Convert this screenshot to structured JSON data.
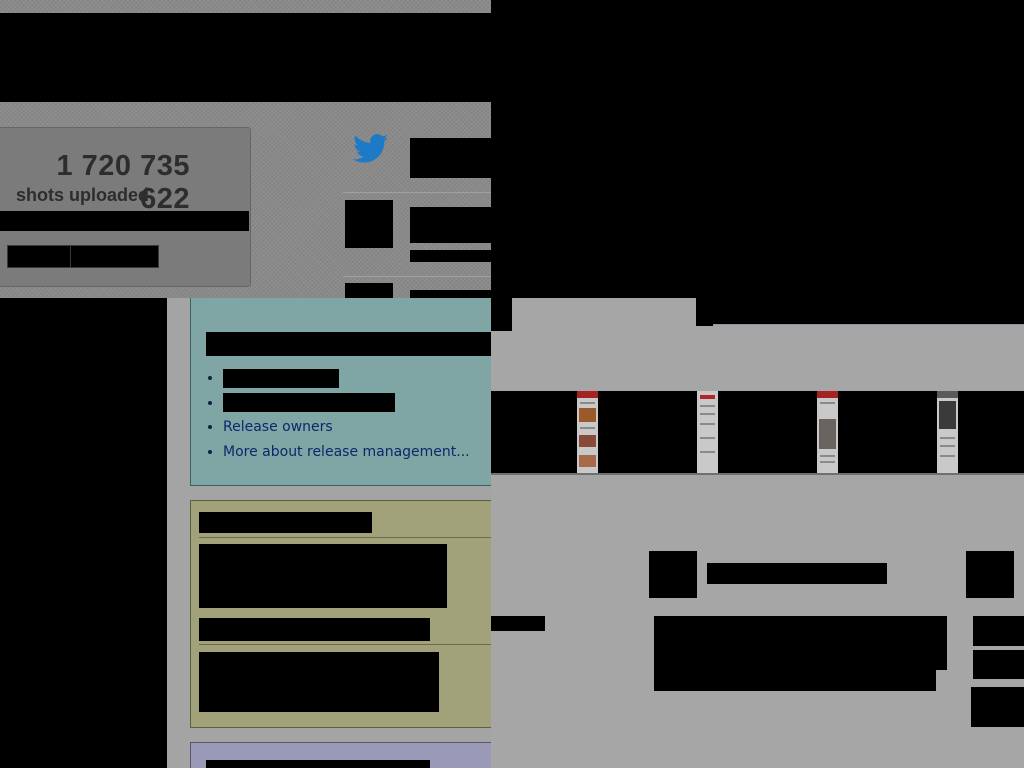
{
  "stats": {
    "count": "1 720 735 622",
    "label": "shots uploaded"
  },
  "social": {
    "icon": "twitter-bird-icon",
    "color": "#1d7ac7"
  },
  "release": {
    "links": [
      "",
      "",
      "Release owners",
      "More about release management..."
    ]
  },
  "gallery": {
    "thumbnails": [
      "page-thumbnail",
      "page-thumbnail",
      "page-thumbnail",
      "page-thumbnail"
    ]
  },
  "colors": {
    "release_box": "#7fa6a4",
    "yellow_box": "#a2a27a",
    "purple_box": "#9a9ab8",
    "link": "#10266a"
  }
}
